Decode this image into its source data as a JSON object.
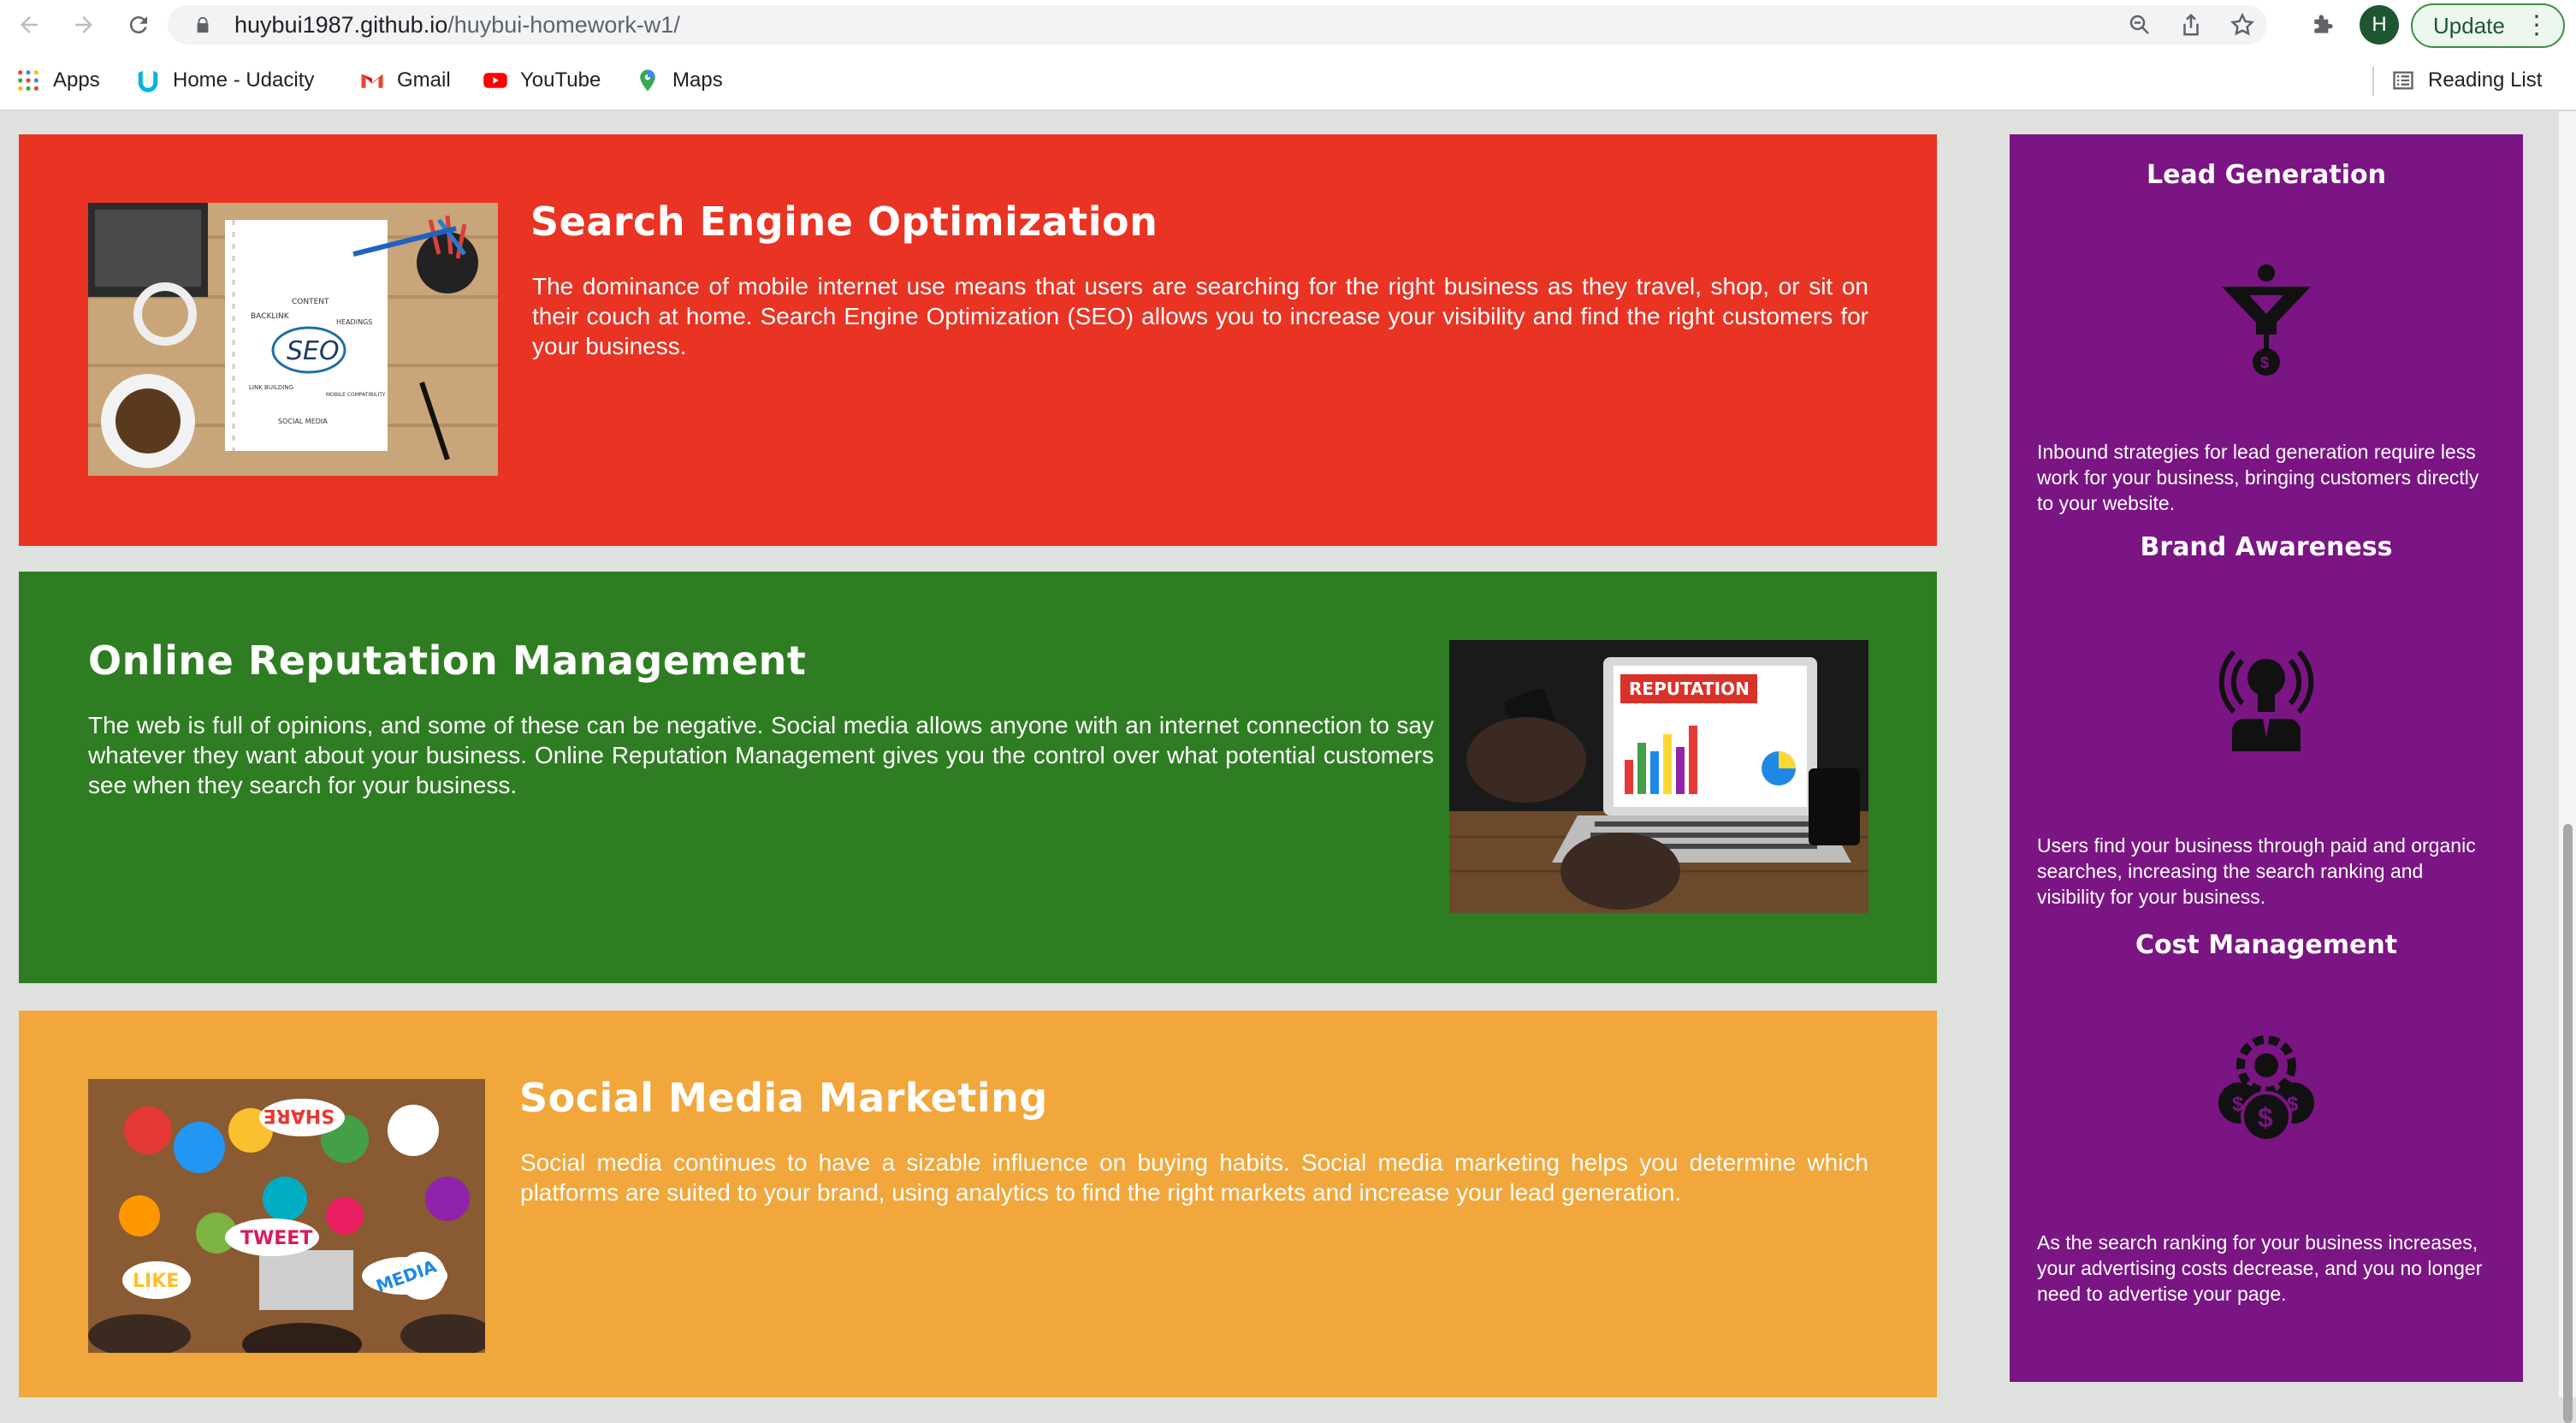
{
  "browser": {
    "url_host": "huybui1987.github.io",
    "url_path": "/huybui-homework-w1/",
    "avatar_initial": "H",
    "update_label": "Update",
    "bookmarks": [
      {
        "label": "Apps",
        "icon": "apps-grid-icon"
      },
      {
        "label": "Home - Udacity",
        "icon": "udacity-icon"
      },
      {
        "label": "Gmail",
        "icon": "gmail-icon"
      },
      {
        "label": "YouTube",
        "icon": "youtube-icon"
      },
      {
        "label": "Maps",
        "icon": "maps-icon"
      }
    ],
    "reading_list_label": "Reading List"
  },
  "sections": [
    {
      "title": "Search Engine Optimization",
      "text": "The dominance of mobile internet use means that users are searching for the right business as they travel, shop, or sit on their couch at home. Search Engine Optimization (SEO) allows you to increase your visibility and find the right customers for your business.",
      "color": "#e93323",
      "image_labels": [
        "SEO",
        "CONTENT",
        "BACKLINK",
        "HEADINGS",
        "LINK BUILDING",
        "MOBILE COMPATIBILITY",
        "SOCIAL MEDIA"
      ]
    },
    {
      "title": "Online Reputation Management",
      "text": "The web is full of opinions, and some of these can be negative. Social media allows anyone with an internet connection to say whatever they want about your business. Online Reputation Management gives you the control over what potential customers see when they search for your business.",
      "color": "#2e7d22",
      "image_labels": [
        "REPUTATION"
      ]
    },
    {
      "title": "Social Media Marketing",
      "text": "Social media continues to have a sizable influence on buying habits. Social media marketing helps you determine which platforms are suited to your brand, using analytics to find the right markets and increase your lead generation.",
      "color": "#f1a73b",
      "image_labels": [
        "SHARE",
        "TWEET",
        "LIKE",
        "MEDIA"
      ]
    }
  ],
  "aside": {
    "color": "#7a1583",
    "features": [
      {
        "title": "Lead Generation",
        "icon": "funnel-dollar-icon",
        "text": "Inbound strategies for lead generation require less work for your business, bringing customers directly to your website."
      },
      {
        "title": "Brand Awareness",
        "icon": "lightbulb-broadcast-icon",
        "text": "Users find your business through paid and organic searches, increasing the search ranking and visibility for your business."
      },
      {
        "title": "Cost Management",
        "icon": "gear-dollar-icon",
        "text": "As the search ranking for your business increases, your advertising costs decrease, and you no longer need to advertise your page."
      }
    ]
  }
}
